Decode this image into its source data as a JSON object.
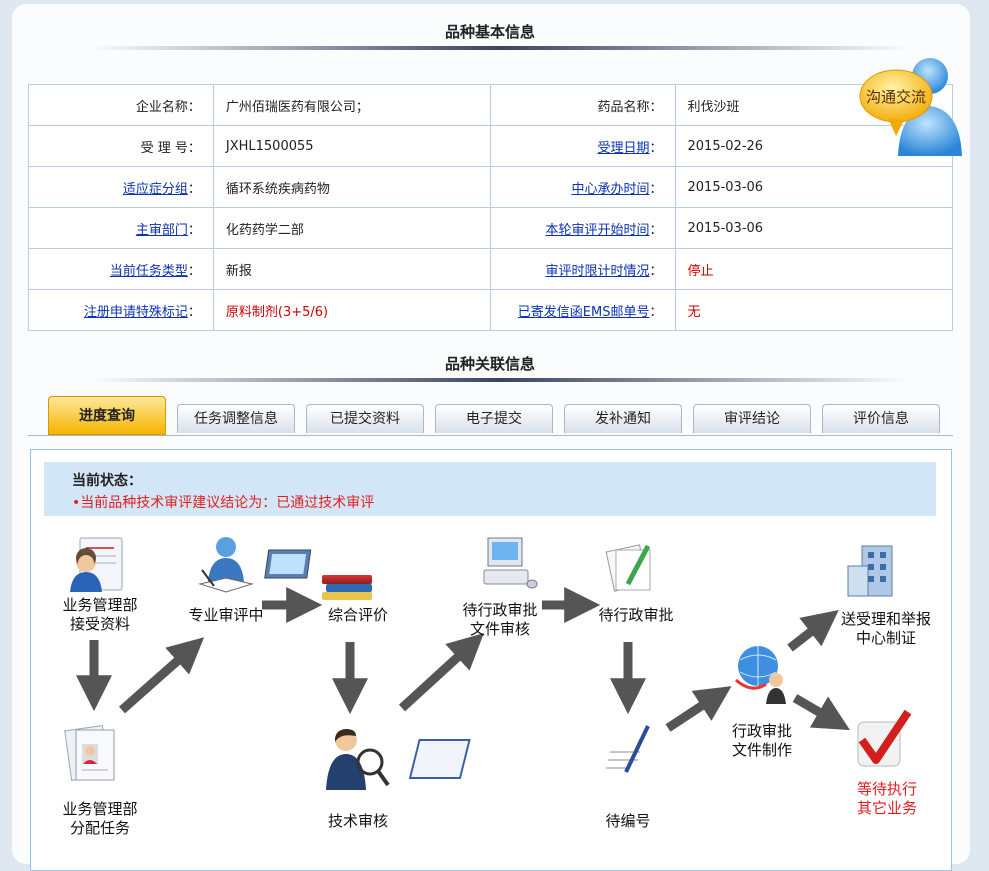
{
  "sections": {
    "basic_title": "品种基本信息",
    "related_title": "品种关联信息"
  },
  "chat_bubble_label": "沟通交流",
  "info": {
    "company_label": "企业名称",
    "company_value": "广州佰瑞医药有限公司；",
    "drug_label": "药品名称",
    "drug_value": "利伐沙班",
    "accept_no_label": "受 理 号",
    "accept_no_value": "JXHL1500055",
    "accept_date_label": "受理日期",
    "accept_date_value": "2015-02-26",
    "indication_label": "适应症分组",
    "indication_value": "循环系统疾病药物",
    "center_time_label": "中心承办时间",
    "center_time_value": "2015-03-06",
    "dept_label": "主审部门",
    "dept_value": "化药药学二部",
    "round_start_label": "本轮审评开始时间",
    "round_start_value": "2015-03-06",
    "task_type_label": "当前任务类型",
    "task_type_value": "新报",
    "time_limit_label": "审评时限计时情况",
    "time_limit_value": "停止",
    "special_mark_label": "注册申请特殊标记",
    "special_mark_value": "原料制剂(3+5/6)",
    "ems_label": "已寄发信函EMS邮单号",
    "ems_value": "无",
    "colon": "："
  },
  "tabs": [
    "进度查询",
    "任务调整信息",
    "已提交资料",
    "电子提交",
    "发补通知",
    "审评结论",
    "评价信息"
  ],
  "status": {
    "title": "当前状态：",
    "message": "•当前品种技术审评建议结论为：已通过技术审评"
  },
  "flow_nodes": {
    "receive": [
      "业务管理部",
      "接受资料"
    ],
    "assign": [
      "业务管理部",
      "分配任务"
    ],
    "review": [
      "专业审评中"
    ],
    "evaluate": [
      "综合评价"
    ],
    "tech_review": [
      "技术审核"
    ],
    "admin_pending_file": [
      "待行政审批",
      "文件审核"
    ],
    "admin_pending": [
      "待行政审批"
    ],
    "numbering": [
      "待编号"
    ],
    "admin_doc": [
      "行政审批",
      "文件制作"
    ],
    "send_center": [
      "送受理和举报",
      "中心制证"
    ],
    "await_other": [
      "等待执行",
      "其它业务"
    ]
  },
  "colors": {
    "link": "#0b33b3",
    "alert": "#cc0000",
    "tab_active": "#f5b400",
    "arrow": "#555555",
    "status_bg": "#d3e6f7"
  }
}
